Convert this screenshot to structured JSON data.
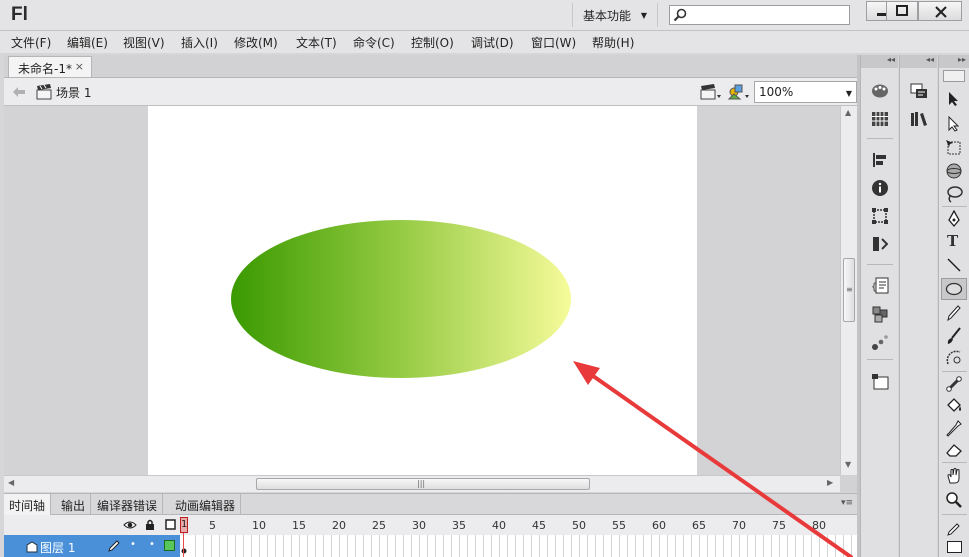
{
  "app": {
    "logo": "Fl",
    "workspace": "基本功能",
    "search": {
      "placeholder": ""
    }
  },
  "menu": [
    "文件(F)",
    "编辑(E)",
    "视图(V)",
    "插入(I)",
    "修改(M)",
    "文本(T)",
    "命令(C)",
    "控制(O)",
    "调试(D)",
    "窗口(W)",
    "帮助(H)"
  ],
  "document": {
    "tab_label": "未命名-1*",
    "tab_close": "×",
    "scene_label": "场景 1",
    "zoom": "100%"
  },
  "stage_shape": {
    "type": "ellipse",
    "gradient": [
      "#3a9a00",
      "#8cc63c",
      "#f6fb9a"
    ]
  },
  "annotation": {
    "color": "#e83a3a"
  },
  "timeline": {
    "tabs": [
      "时间轴",
      "输出",
      "编译器错误",
      "动画编辑器"
    ],
    "current_frame": "1",
    "frame_numbers": [
      "5",
      "10",
      "15",
      "20",
      "25",
      "30",
      "35",
      "40",
      "45",
      "50",
      "55",
      "60",
      "65",
      "70",
      "75",
      "80"
    ],
    "layer_name": "图层 1"
  },
  "colors": {
    "accent": "#4a90d9",
    "playhead": "#e84a4a"
  }
}
